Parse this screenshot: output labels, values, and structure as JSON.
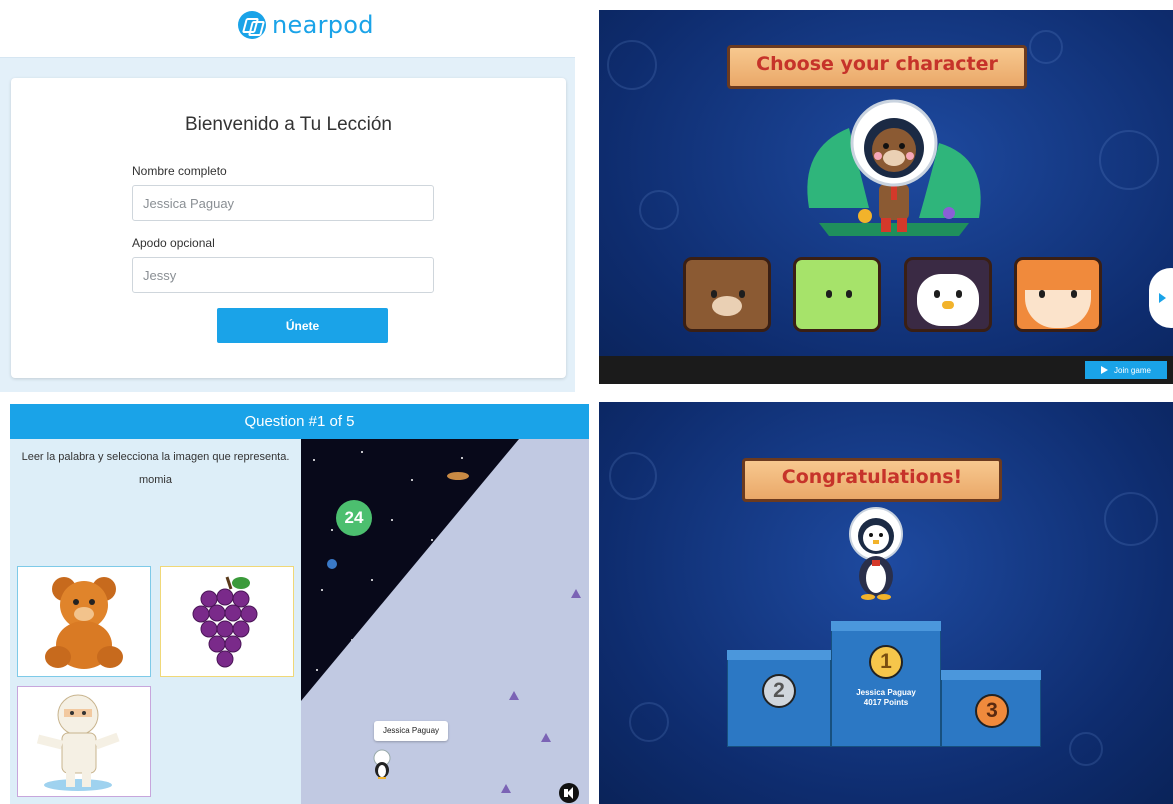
{
  "join_form": {
    "brand": "nearpod",
    "title": "Bienvenido a Tu Lección",
    "name_label": "Nombre completo",
    "name_value": "Jessica Paguay",
    "nickname_label": "Apodo opcional",
    "nickname_value": "Jessy",
    "submit_label": "Únete"
  },
  "character_select": {
    "title": "Choose your character",
    "characters": [
      "bear",
      "dino",
      "penguin",
      "fox"
    ],
    "join_button": "Join game"
  },
  "quiz": {
    "header": "Question #1 of 5",
    "instruction": "Leer la palabra y selecciona la imagen que representa.",
    "word": "momia",
    "options": [
      "teddy-bear",
      "grapes",
      "mummy"
    ],
    "timer": "24",
    "player_name": "Jessica Paguay"
  },
  "results": {
    "title": "Congratulations!",
    "first_rank": "1",
    "second_rank": "2",
    "third_rank": "3",
    "winner_name": "Jessica Paguay",
    "winner_points": "4017 Points"
  },
  "colors": {
    "accent": "#1aa3e8",
    "space_blue": "#0e2c6e",
    "ribbon_text": "#c6332a"
  }
}
